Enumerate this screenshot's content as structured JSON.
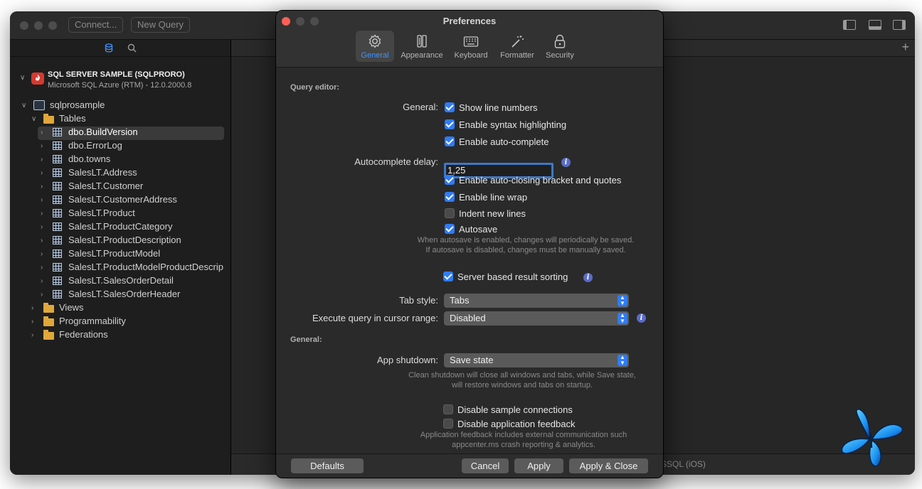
{
  "main": {
    "connect_label": "Connect...",
    "new_query_label": "New Query",
    "bottom_text": "SSQL (iOS)",
    "plus": "+"
  },
  "sidebar": {
    "server_name": "SQL SERVER SAMPLE (SQLPRORO)",
    "server_version": "Microsoft SQL Azure (RTM) - 12.0.2000.8",
    "database": "sqlprosample",
    "tables_label": "Tables",
    "tables": [
      "dbo.BuildVersion",
      "dbo.ErrorLog",
      "dbo.towns",
      "SalesLT.Address",
      "SalesLT.Customer",
      "SalesLT.CustomerAddress",
      "SalesLT.Product",
      "SalesLT.ProductCategory",
      "SalesLT.ProductDescription",
      "SalesLT.ProductModel",
      "SalesLT.ProductModelProductDescrip",
      "SalesLT.SalesOrderDetail",
      "SalesLT.SalesOrderHeader"
    ],
    "folders": [
      "Views",
      "Programmability",
      "Federations"
    ]
  },
  "prefs": {
    "title": "Preferences",
    "tabs": [
      "General",
      "Appearance",
      "Keyboard",
      "Formatter",
      "Security"
    ],
    "section_query_editor": "Query editor:",
    "general_label": "General:",
    "opt_line_numbers": "Show line numbers",
    "opt_syntax": "Enable syntax highlighting",
    "opt_autocomplete": "Enable auto-complete",
    "autocomplete_delay_label": "Autocomplete delay:",
    "autocomplete_delay_value": "1,25",
    "opt_auto_closing": "Enable auto-closing bracket and quotes",
    "opt_line_wrap": "Enable line wrap",
    "opt_indent": "Indent new lines",
    "opt_autosave": "Autosave",
    "autosave_note": "When autosave is enabled, changes will periodically be saved. If autosave is disabled, changes must be manually saved.",
    "opt_server_sort": "Server based result sorting",
    "tab_style_label": "Tab style:",
    "tab_style_value": "Tabs",
    "exec_range_label": "Execute query in cursor range:",
    "exec_range_value": "Disabled",
    "section_general": "General:",
    "app_shutdown_label": "App shutdown:",
    "app_shutdown_value": "Save state",
    "shutdown_note": "Clean shutdown will close all windows and tabs, while Save state, will restore windows and tabs on startup.",
    "opt_disable_sample": "Disable sample connections",
    "opt_disable_feedback": "Disable application feedback",
    "feedback_note": "Application feedback includes external communication such appcenter.ms crash reporting & analytics.",
    "btn_defaults": "Defaults",
    "btn_cancel": "Cancel",
    "btn_apply": "Apply",
    "btn_apply_close": "Apply & Close",
    "info_glyph": "i"
  },
  "colors": {
    "accent": "#2f7cf6",
    "close": "#ff5f57",
    "dialog_bg": "#2d2d2d"
  }
}
